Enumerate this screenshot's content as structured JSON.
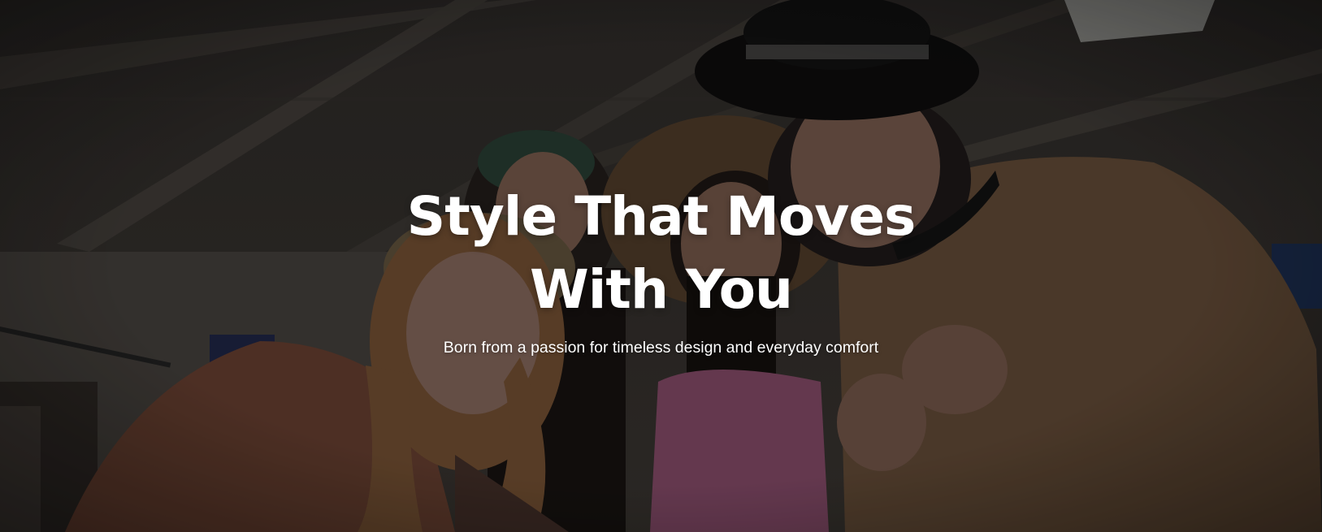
{
  "hero": {
    "title_line_1": "Style That Moves",
    "title_line_2": "With You",
    "subtitle": "Born from a passion for timeless design and everyday comfort"
  },
  "colors": {
    "text": "#ffffff",
    "overlay": "#1e1b19"
  },
  "icons": []
}
